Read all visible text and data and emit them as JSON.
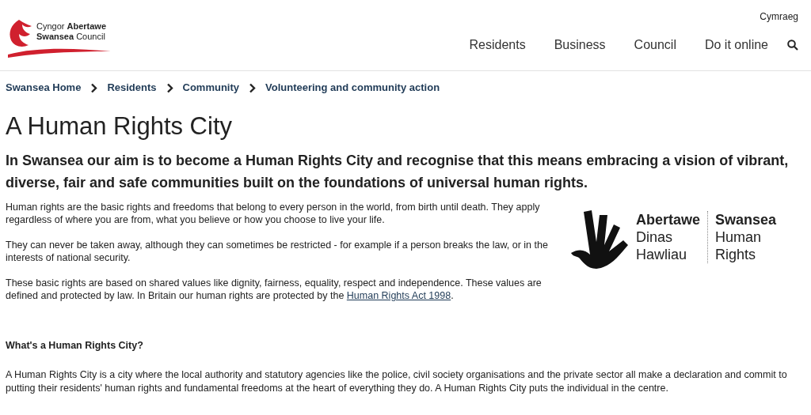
{
  "header": {
    "logo_lines": [
      "Cyngor **Abertawe**",
      "**Swansea** Council"
    ],
    "language_link": "Cymraeg",
    "nav": [
      "Residents",
      "Business",
      "Council",
      "Do it online"
    ]
  },
  "breadcrumb": [
    "Swansea Home",
    "Residents",
    "Community",
    "Volunteering and community action"
  ],
  "title": "A Human Rights City",
  "lead": "In Swansea our aim is to become a Human Rights City and recognise that this means embracing a vision of vibrant, diverse, fair and safe communities built on the foundations of universal human rights.",
  "paragraphs": [
    {
      "text": "Human rights are the basic rights and freedoms that belong to every person in the world, from birth until death. They apply regardless of where you are from, what you believe or how you choose to live your life."
    },
    {
      "text": "They can never be taken away, although they can sometimes be restricted - for example if a person breaks the law, or in the interests of national security."
    },
    {
      "text": "These basic rights are based on shared values like dignity, fairness, equality, respect and independence. These values are defined and protected by law. In Britain our human rights are protected by the ",
      "link": "Human Rights Act 1998",
      "after": "."
    }
  ],
  "hr_logo": {
    "welsh": [
      "Abertawe",
      "Dinas",
      "Hawliau"
    ],
    "english": [
      "Swansea",
      "Human",
      "Rights"
    ]
  },
  "section": {
    "heading": "What's a Human Rights City?",
    "text": "A Human Rights City is a city where the local authority and statutory agencies like the police, civil society organisations and the private sector all make a declaration and commit to putting their residents' human rights and fundamental freedoms at the heart of everything they do. A Human Rights City puts the individual in the centre."
  }
}
